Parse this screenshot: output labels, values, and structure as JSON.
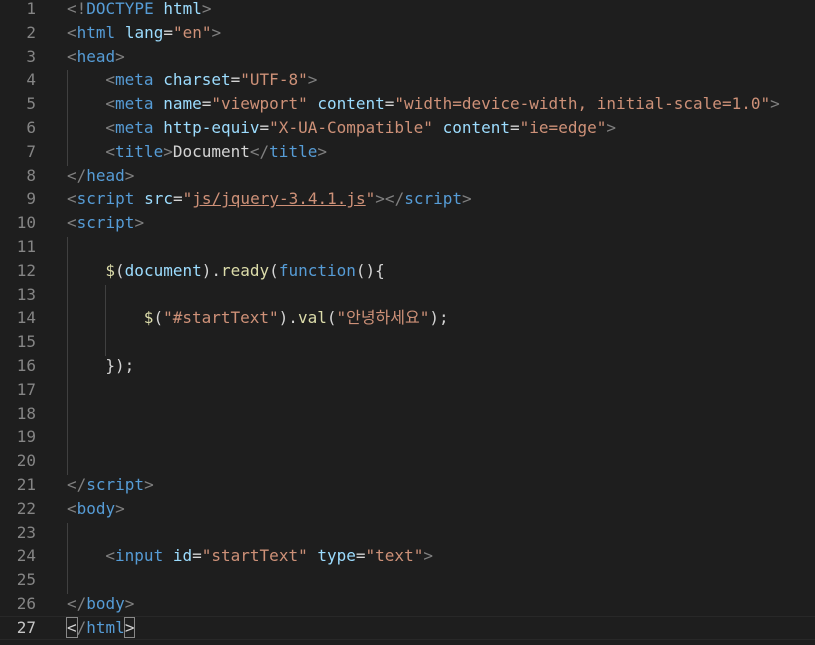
{
  "editor": {
    "active_line": 27,
    "colors": {
      "background": "#1e1e1e",
      "line_number": "#858585",
      "punctuation": "#808080",
      "tag": "#569cd6",
      "attribute": "#9cdcfe",
      "string": "#ce9178",
      "function": "#dcdcaa",
      "text": "#d4d4d4"
    },
    "lines": [
      {
        "n": "1",
        "indent": 0,
        "tokens": [
          {
            "t": "punc",
            "v": "<!"
          },
          {
            "t": "doct",
            "v": "DOCTYPE"
          },
          {
            "t": "text",
            "v": " "
          },
          {
            "t": "attr",
            "v": "html"
          },
          {
            "t": "punc",
            "v": ">"
          }
        ]
      },
      {
        "n": "2",
        "indent": 0,
        "tokens": [
          {
            "t": "punc",
            "v": "<"
          },
          {
            "t": "tag",
            "v": "html"
          },
          {
            "t": "text",
            "v": " "
          },
          {
            "t": "attr",
            "v": "lang"
          },
          {
            "t": "text",
            "v": "="
          },
          {
            "t": "str",
            "v": "\"en\""
          },
          {
            "t": "punc",
            "v": ">"
          }
        ]
      },
      {
        "n": "3",
        "indent": 0,
        "tokens": [
          {
            "t": "punc",
            "v": "<"
          },
          {
            "t": "tag",
            "v": "head"
          },
          {
            "t": "punc",
            "v": ">"
          }
        ]
      },
      {
        "n": "4",
        "indent": 1,
        "tokens": [
          {
            "t": "punc",
            "v": "<"
          },
          {
            "t": "tag",
            "v": "meta"
          },
          {
            "t": "text",
            "v": " "
          },
          {
            "t": "attr",
            "v": "charset"
          },
          {
            "t": "text",
            "v": "="
          },
          {
            "t": "str",
            "v": "\"UTF-8\""
          },
          {
            "t": "punc",
            "v": ">"
          }
        ]
      },
      {
        "n": "5",
        "indent": 1,
        "tokens": [
          {
            "t": "punc",
            "v": "<"
          },
          {
            "t": "tag",
            "v": "meta"
          },
          {
            "t": "text",
            "v": " "
          },
          {
            "t": "attr",
            "v": "name"
          },
          {
            "t": "text",
            "v": "="
          },
          {
            "t": "str",
            "v": "\"viewport\""
          },
          {
            "t": "text",
            "v": " "
          },
          {
            "t": "attr",
            "v": "content"
          },
          {
            "t": "text",
            "v": "="
          },
          {
            "t": "str",
            "v": "\"width=device-width, initial-scale=1.0\""
          },
          {
            "t": "punc",
            "v": ">"
          }
        ]
      },
      {
        "n": "6",
        "indent": 1,
        "tokens": [
          {
            "t": "punc",
            "v": "<"
          },
          {
            "t": "tag",
            "v": "meta"
          },
          {
            "t": "text",
            "v": " "
          },
          {
            "t": "attr",
            "v": "http-equiv"
          },
          {
            "t": "text",
            "v": "="
          },
          {
            "t": "str",
            "v": "\"X-UA-Compatible\""
          },
          {
            "t": "text",
            "v": " "
          },
          {
            "t": "attr",
            "v": "content"
          },
          {
            "t": "text",
            "v": "="
          },
          {
            "t": "str",
            "v": "\"ie=edge\""
          },
          {
            "t": "punc",
            "v": ">"
          }
        ]
      },
      {
        "n": "7",
        "indent": 1,
        "tokens": [
          {
            "t": "punc",
            "v": "<"
          },
          {
            "t": "tag",
            "v": "title"
          },
          {
            "t": "punc",
            "v": ">"
          },
          {
            "t": "text",
            "v": "Document"
          },
          {
            "t": "punc",
            "v": "</"
          },
          {
            "t": "tag",
            "v": "title"
          },
          {
            "t": "punc",
            "v": ">"
          }
        ]
      },
      {
        "n": "8",
        "indent": 0,
        "tokens": [
          {
            "t": "punc",
            "v": "</"
          },
          {
            "t": "tag",
            "v": "head"
          },
          {
            "t": "punc",
            "v": ">"
          }
        ]
      },
      {
        "n": "9",
        "indent": 0,
        "tokens": [
          {
            "t": "punc",
            "v": "<"
          },
          {
            "t": "tag",
            "v": "script"
          },
          {
            "t": "text",
            "v": " "
          },
          {
            "t": "attr",
            "v": "src"
          },
          {
            "t": "text",
            "v": "="
          },
          {
            "t": "str",
            "v": "\""
          },
          {
            "t": "link",
            "v": "js/jquery-3.4.1.js"
          },
          {
            "t": "str",
            "v": "\""
          },
          {
            "t": "punc",
            "v": "></"
          },
          {
            "t": "tag",
            "v": "script"
          },
          {
            "t": "punc",
            "v": ">"
          }
        ]
      },
      {
        "n": "10",
        "indent": 0,
        "tokens": [
          {
            "t": "punc",
            "v": "<"
          },
          {
            "t": "tag",
            "v": "script"
          },
          {
            "t": "punc",
            "v": ">"
          }
        ]
      },
      {
        "n": "11",
        "indent": 0,
        "tokens": []
      },
      {
        "n": "12",
        "indent": 1,
        "tokens": [
          {
            "t": "fn",
            "v": "$"
          },
          {
            "t": "text",
            "v": "("
          },
          {
            "t": "attr",
            "v": "document"
          },
          {
            "t": "text",
            "v": ")."
          },
          {
            "t": "fn",
            "v": "ready"
          },
          {
            "t": "text",
            "v": "("
          },
          {
            "t": "kw",
            "v": "function"
          },
          {
            "t": "text",
            "v": "(){"
          }
        ]
      },
      {
        "n": "13",
        "indent": 0,
        "tokens": []
      },
      {
        "n": "14",
        "indent": 2,
        "tokens": [
          {
            "t": "fn",
            "v": "$"
          },
          {
            "t": "text",
            "v": "("
          },
          {
            "t": "str",
            "v": "\"#startText\""
          },
          {
            "t": "text",
            "v": ")."
          },
          {
            "t": "fn",
            "v": "val"
          },
          {
            "t": "text",
            "v": "("
          },
          {
            "t": "str",
            "v": "\"안녕하세요\""
          },
          {
            "t": "text",
            "v": ");"
          }
        ]
      },
      {
        "n": "15",
        "indent": 0,
        "tokens": []
      },
      {
        "n": "16",
        "indent": 1,
        "tokens": [
          {
            "t": "text",
            "v": "});"
          }
        ]
      },
      {
        "n": "17",
        "indent": 0,
        "tokens": []
      },
      {
        "n": "18",
        "indent": 0,
        "tokens": []
      },
      {
        "n": "19",
        "indent": 0,
        "tokens": []
      },
      {
        "n": "20",
        "indent": 0,
        "tokens": []
      },
      {
        "n": "21",
        "indent": 0,
        "tokens": [
          {
            "t": "punc",
            "v": "</"
          },
          {
            "t": "tag",
            "v": "script"
          },
          {
            "t": "punc",
            "v": ">"
          }
        ]
      },
      {
        "n": "22",
        "indent": 0,
        "tokens": [
          {
            "t": "punc",
            "v": "<"
          },
          {
            "t": "tag",
            "v": "body"
          },
          {
            "t": "punc",
            "v": ">"
          }
        ]
      },
      {
        "n": "23",
        "indent": 0,
        "tokens": []
      },
      {
        "n": "24",
        "indent": 1,
        "tokens": [
          {
            "t": "punc",
            "v": "<"
          },
          {
            "t": "tag",
            "v": "input"
          },
          {
            "t": "text",
            "v": " "
          },
          {
            "t": "attr",
            "v": "id"
          },
          {
            "t": "text",
            "v": "="
          },
          {
            "t": "str",
            "v": "\"startText\""
          },
          {
            "t": "text",
            "v": " "
          },
          {
            "t": "attr",
            "v": "type"
          },
          {
            "t": "text",
            "v": "="
          },
          {
            "t": "str",
            "v": "\"text\""
          },
          {
            "t": "punc",
            "v": ">"
          }
        ]
      },
      {
        "n": "25",
        "indent": 0,
        "tokens": []
      },
      {
        "n": "26",
        "indent": 0,
        "tokens": [
          {
            "t": "punc",
            "v": "</"
          },
          {
            "t": "tag",
            "v": "body"
          },
          {
            "t": "punc",
            "v": ">"
          }
        ]
      },
      {
        "n": "27",
        "indent": 0,
        "tokens": [
          {
            "t": "bracket",
            "v": "<"
          },
          {
            "t": "punc",
            "v": "/"
          },
          {
            "t": "tag",
            "v": "html"
          },
          {
            "t": "bracket",
            "v": ">"
          }
        ]
      }
    ]
  }
}
